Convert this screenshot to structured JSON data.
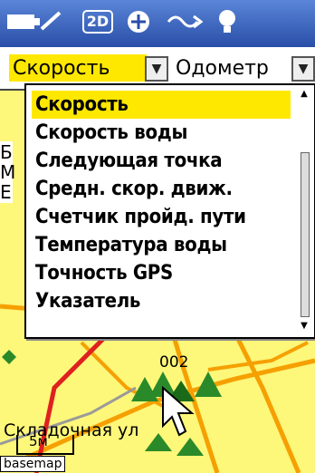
{
  "statusbar": {
    "icons": [
      "battery-icon",
      "2d-gps-icon",
      "satellite-icon",
      "signal-wave-icon",
      "backlight-icon"
    ],
    "gps_mode_label": "2D"
  },
  "fields": {
    "left_label": "Скорость",
    "right_label": "Одометр"
  },
  "dropdown": {
    "items": [
      "Скорость",
      "Скорость воды",
      "Следующая точка",
      "Средн. скор. движ.",
      "Счетчик пройд. пути",
      "Температура воды",
      "Точность GPS",
      "Указатель"
    ],
    "selected_index": 0
  },
  "map": {
    "waypoint_label": "002",
    "street_label": "Складочная ул",
    "scale_label": "5м",
    "basemap_label": "basemap",
    "side_letters": [
      "Б",
      "М",
      "Е"
    ]
  },
  "colors": {
    "statusbar": "#3a64c4",
    "highlight": "#ffe800",
    "map_bg": "#fdf77a",
    "road": "#f5a000",
    "route": "#e02020"
  }
}
